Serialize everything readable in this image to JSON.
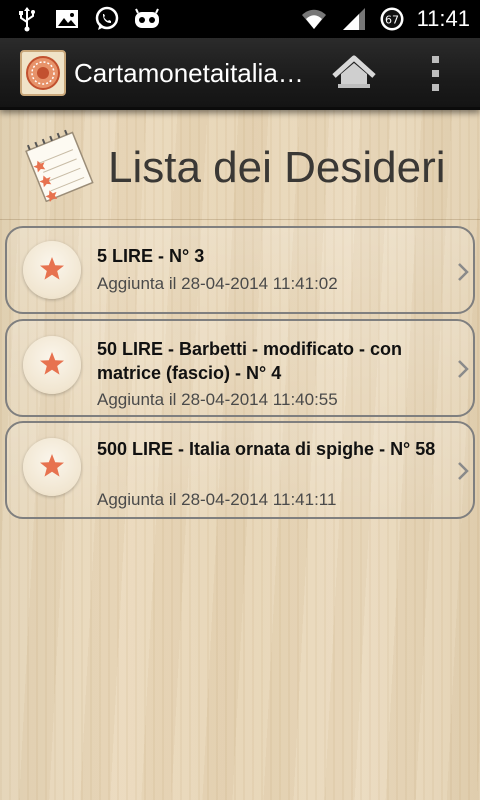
{
  "status_bar": {
    "time": "11:41",
    "battery_level": "67",
    "left_icons": [
      "usb-icon",
      "image-icon",
      "whatsapp-icon",
      "android-icon"
    ],
    "right_icons": [
      "wifi-icon",
      "signal-icon",
      "battery-icon"
    ]
  },
  "action_bar": {
    "app_title": "Cartamonetaitaliana",
    "icons": [
      "app-logo-icon",
      "home-icon",
      "overflow-menu-icon"
    ]
  },
  "header": {
    "title": "Lista dei Desideri",
    "icon": "notepad-stars-icon"
  },
  "items": [
    {
      "title": "5 LIRE - N° 3",
      "date": "Aggiunta il 28-04-2014 11:41:02"
    },
    {
      "title": "50 LIRE - Barbetti - modificato - con matrice (fascio) - N° 4",
      "date": "Aggiunta il 28-04-2014 11:40:55"
    },
    {
      "title": "500 LIRE - Italia ornata di spighe - N° 58",
      "date": "Aggiunta il 28-04-2014 11:41:11"
    }
  ],
  "colors": {
    "star": "#e7724f",
    "action_bar": "#1e1e1e",
    "title_text": "#3a3835"
  }
}
